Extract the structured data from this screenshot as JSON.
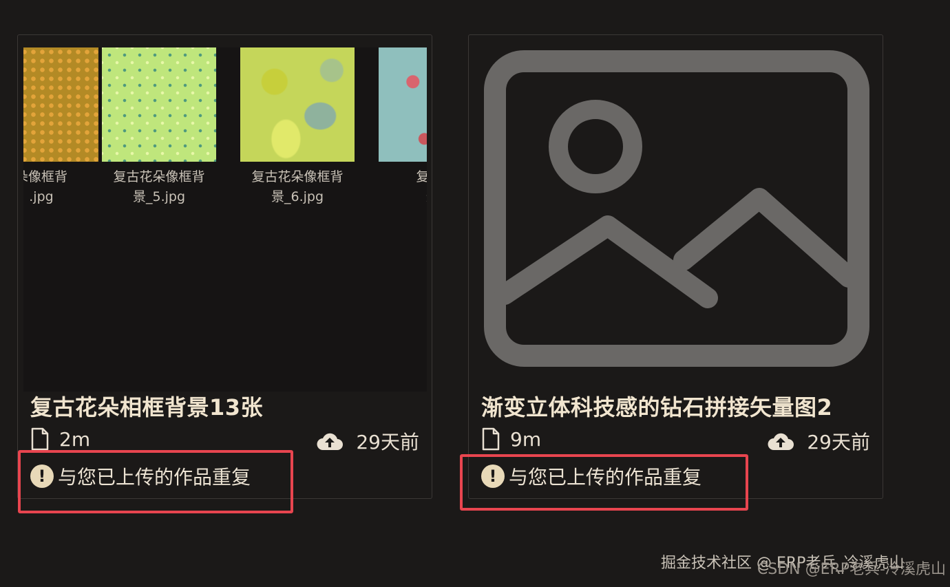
{
  "cards": [
    {
      "title": "复古花朵相框背景13张",
      "size": "2m",
      "time": "29天前",
      "warning": "与您已上传的作品重复",
      "thumbnails": [
        {
          "file": ".jpg",
          "icon": "pattern-thumbnail"
        },
        {
          "file": "复古花朵像框背\n景_5.jpg",
          "icon": "pattern-thumbnail"
        },
        {
          "file": "复古花朵像框背\n景_6.jpg",
          "icon": "pattern-thumbnail"
        },
        {
          "file": "复古花\n景_",
          "icon": "pattern-thumbnail"
        }
      ],
      "tile_1_fragment": "朵像框背"
    },
    {
      "title": "渐变立体科技感的钻石拼接矢量图2",
      "size": "9m",
      "time": "29天前",
      "warning": "与您已上传的作品重复",
      "preview_icon": "image-placeholder-icon"
    }
  ],
  "watermarks": {
    "primary": "掘金技术社区 @ ERP老兵_冷溪虎山",
    "secondary": "CSDN @ERP老兵-冷溪虎山"
  },
  "colors": {
    "background": "#1b1918",
    "highlight": "#e8454f",
    "text": "#efe6d6"
  }
}
